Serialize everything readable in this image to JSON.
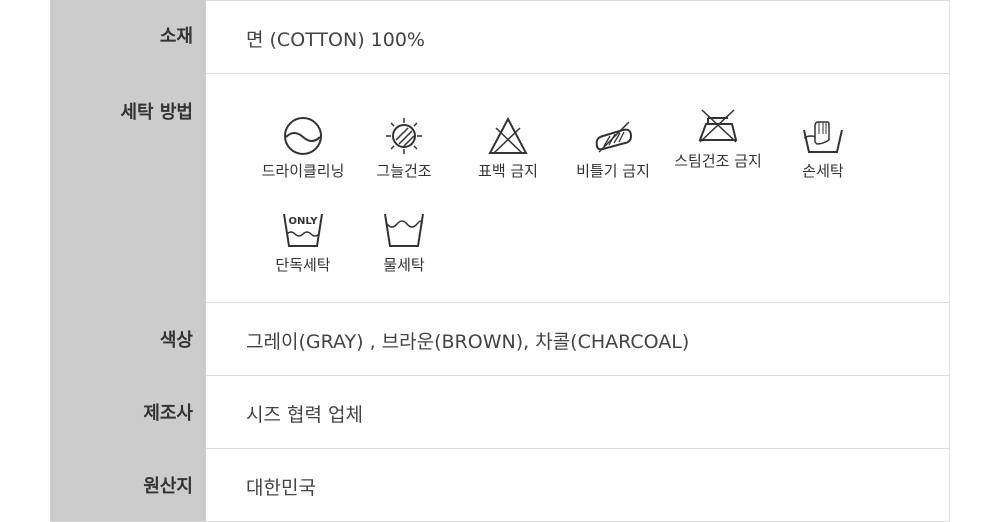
{
  "rows": {
    "material": {
      "label": "소재",
      "value": "면 (COTTON) 100%"
    },
    "washing": {
      "label": "세탁 방법",
      "icons": [
        {
          "icon": "dry-cleaning-icon",
          "label": "드라이클리닝"
        },
        {
          "icon": "shade-dry-icon",
          "label": "그늘건조"
        },
        {
          "icon": "no-bleach-icon",
          "label": "표백 금지"
        },
        {
          "icon": "no-wring-icon",
          "label": "비틀기 금지"
        },
        {
          "icon": "no-steam-iron-icon",
          "label": "스팀건조 금지"
        },
        {
          "icon": "hand-wash-icon",
          "label": "손세탁"
        },
        {
          "icon": "wash-separately-icon",
          "label": "단독세탁",
          "badge": "ONLY"
        },
        {
          "icon": "water-wash-icon",
          "label": "물세탁"
        }
      ]
    },
    "color": {
      "label": "색상",
      "value": "그레이(GRAY) , 브라운(BROWN), 차콜(CHARCOAL)"
    },
    "maker": {
      "label": "제조사",
      "value": "시즈 협력 업체"
    },
    "origin": {
      "label": "원산지",
      "value": "대한민국"
    }
  }
}
